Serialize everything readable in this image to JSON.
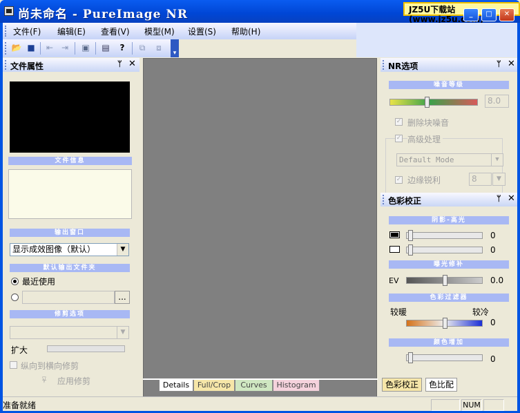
{
  "window": {
    "title": "尚未命名 - PureImage NR",
    "watermark": "JZ5U下载站(www.jz5u.com)"
  },
  "menu": [
    "文件(F)",
    "编辑(E)",
    "查看(V)",
    "模型(M)",
    "设置(S)",
    "帮助(H)"
  ],
  "left_panel": {
    "title": "文件属性",
    "file_info_section": "文件信息",
    "output_window_section": "输出窗口",
    "output_window_value": "显示成效图像（默认）",
    "default_output_folder_section": "默认输出文件夹",
    "recent_label": "最近使用",
    "browse_label": "...",
    "crop_section": "修剪选项",
    "expand_label": "扩大",
    "crop_vertical_label": "纵向到横向修剪",
    "apply_crop_label": "应用修剪"
  },
  "center": {
    "tabs": [
      "Details",
      "Full/Crop",
      "Curves",
      "Histogram"
    ]
  },
  "nr_panel": {
    "title": "NR选项",
    "noise_level_section": "噪音等级",
    "noise_level_value": "8.0",
    "noise_level_fraction": 0.42,
    "remove_block_label": "删除块噪音",
    "advanced_label": "高级处理",
    "mode_value": "Default Mode",
    "edge_sharpen_label": "边缘锐利",
    "edge_value": "8"
  },
  "color_panel": {
    "title": "色彩校正",
    "shadow_highlight_section": "阴影-高光",
    "shadow_value": "0",
    "highlight_value": "0",
    "exposure_section": "曝光修补",
    "ev_label": "EV",
    "ev_value": "0.0",
    "color_filter_section": "色彩过滤器",
    "warmer_label": "较暖",
    "cooler_label": "较冷",
    "color_filter_value": "0",
    "saturation_section": "颜色增加",
    "saturation_value": "0",
    "bottom_tabs": [
      "色彩校正",
      "色比配"
    ]
  },
  "statusbar": {
    "text": "准备就绪",
    "num": "NUM"
  }
}
